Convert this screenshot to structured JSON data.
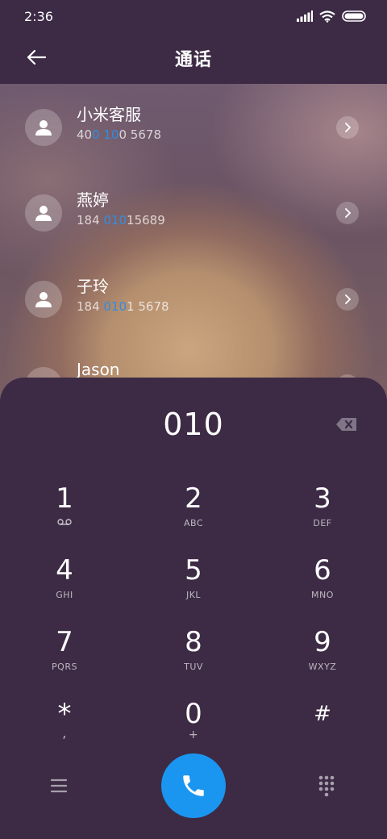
{
  "status": {
    "time": "2:36"
  },
  "header": {
    "title": "通话"
  },
  "contacts": [
    {
      "name": "小米客服",
      "number_parts": [
        "40",
        "0 10",
        "0 5678"
      ]
    },
    {
      "name": "燕婷",
      "number_parts": [
        "184 ",
        "010",
        "15689"
      ]
    },
    {
      "name": "子玲",
      "number_parts": [
        "184 ",
        "010",
        "1 5678"
      ]
    },
    {
      "name": "Jason",
      "number_parts": [
        "",
        "",
        ""
      ]
    }
  ],
  "dialer": {
    "input": "010",
    "keys": [
      {
        "digit": "1",
        "letters": ""
      },
      {
        "digit": "2",
        "letters": "ABC"
      },
      {
        "digit": "3",
        "letters": "DEF"
      },
      {
        "digit": "4",
        "letters": "GHI"
      },
      {
        "digit": "5",
        "letters": "JKL"
      },
      {
        "digit": "6",
        "letters": "MNO"
      },
      {
        "digit": "7",
        "letters": "PQRS"
      },
      {
        "digit": "8",
        "letters": "TUV"
      },
      {
        "digit": "9",
        "letters": "WXYZ"
      },
      {
        "digit": "*",
        "letters": ","
      },
      {
        "digit": "0",
        "letters": "+"
      },
      {
        "digit": "#",
        "letters": ""
      }
    ]
  },
  "colors": {
    "background": "#3d2b45",
    "accent": "#1a96f0",
    "highlight": "#2e8de6"
  },
  "icons": {
    "back": "arrow-left-icon",
    "avatar": "person-icon",
    "chevron": "chevron-right-icon",
    "backspace": "backspace-icon",
    "voicemail": "voicemail-icon",
    "menu": "menu-icon",
    "call": "phone-icon",
    "keypad": "keypad-icon"
  }
}
